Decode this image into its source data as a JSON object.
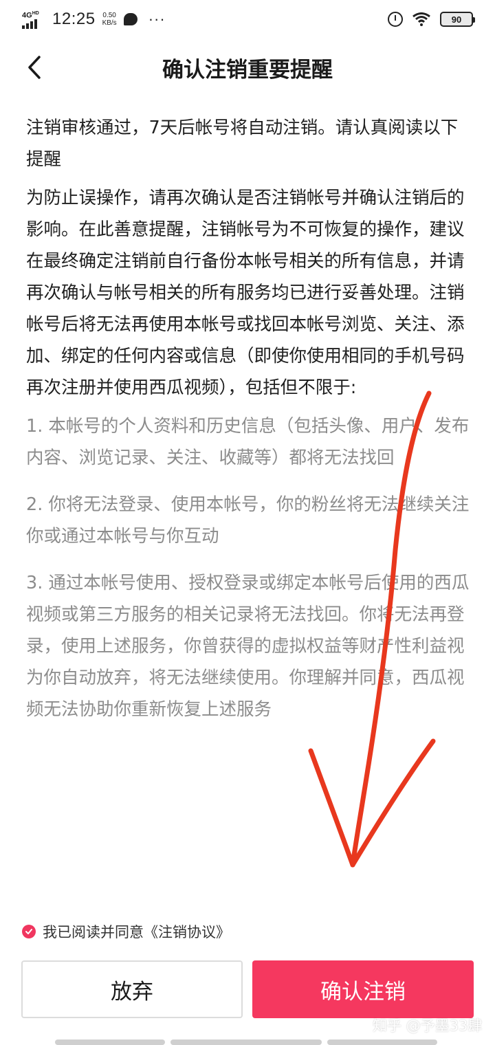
{
  "status_bar": {
    "network": "4G",
    "network_sup": "HD",
    "time": "12:25",
    "speed_value": "0.50",
    "speed_unit": "KB/s",
    "more": "···",
    "battery": "90"
  },
  "header": {
    "title": "确认注销重要提醒"
  },
  "content": {
    "intro": "注销审核通过，7天后帐号将自动注销。请认真阅读以下提醒",
    "warning": "为防止误操作，请再次确认是否注销帐号并确认注销后的影响。在此善意提醒，注销帐号为不可恢复的操作，建议在最终确定注销前自行备份本帐号相关的所有信息，并请再次确认与帐号相关的所有服务均已进行妥善处理。注销帐号后将无法再使用本帐号或找回本帐号浏览、关注、添加、绑定的任何内容或信息（即使你使用相同的手机号码再次注册并使用西瓜视频），包括但不限于:",
    "items": [
      "1. 本帐号的个人资料和历史信息（包括头像、用户、发布内容、浏览记录、关注、收藏等）都将无法找回",
      "2. 你将无法登录、使用本帐号，你的粉丝将无法继续关注你或通过本帐号与你互动",
      "3. 通过本帐号使用、授权登录或绑定本帐号后使用的西瓜视频或第三方服务的相关记录将无法找回。你将无法再登录，使用上述服务，你曾获得的虚拟权益等财产性利益视为你自动放弃，将无法继续使用。你理解并同意，西瓜视频无法协助你重新恢复上述服务"
    ]
  },
  "agreement": {
    "text": "我已阅读并同意《注销协议》",
    "checked": true,
    "check_color": "#f0365f"
  },
  "actions": {
    "cancel_label": "放弃",
    "confirm_label": "确认注销",
    "confirm_color": "#f5385f"
  },
  "watermark": "知乎 @予墨33肆",
  "annotation_color": "#e8381e"
}
